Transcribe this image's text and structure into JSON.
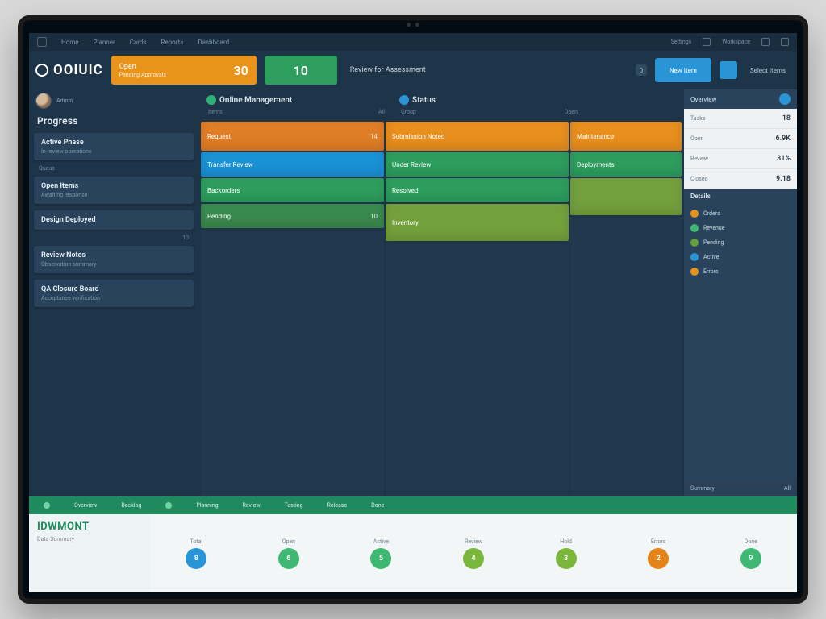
{
  "topnav": {
    "items": [
      "Home",
      "Planner",
      "Cards",
      "Reports",
      "Dashboard"
    ],
    "right": [
      "Settings",
      "Workspace"
    ]
  },
  "brand": "OOIUIC",
  "stats": {
    "orange": {
      "label": "Open",
      "sub": "Pending Approvals",
      "value": "30"
    },
    "green": {
      "value": "10"
    },
    "text": "Review for Assessment",
    "blue": "New Item",
    "gray": "Select Items"
  },
  "avatar_role": "Admin",
  "left": {
    "title": "Progress",
    "items": [
      {
        "title": "Active Phase",
        "sub": "In-review operations"
      },
      {
        "title": "Open Items",
        "sub": "Awaiting response"
      },
      {
        "title": "Design Deployed",
        "sub": ""
      },
      {
        "title": "Review Notes",
        "sub": "Observation summary"
      },
      {
        "title": "QA Closure Board",
        "sub": "Acceptance verification"
      }
    ],
    "small1": "Queue",
    "small2": "10"
  },
  "cols": {
    "left": {
      "title": "Online Management",
      "sub_l": "Items",
      "sub_r": "All"
    },
    "right": {
      "title": "Status",
      "sub_l": "Group",
      "sub_r": "Open"
    }
  },
  "tiles": {
    "l": [
      {
        "cls": "t-orange",
        "label": "Request",
        "num": "14"
      },
      {
        "cls": "t-blue",
        "label": "Transfer Review",
        "num": ""
      },
      {
        "cls": "t-green",
        "label": "Backorders",
        "num": ""
      },
      {
        "cls": "t-darkgreen",
        "label": "Pending",
        "num": "10"
      }
    ],
    "r": [
      {
        "cls": "t-orange2",
        "label": "Submission Noted",
        "num": ""
      },
      {
        "cls": "t-green",
        "label": "Under Review",
        "num": ""
      },
      {
        "cls": "t-green",
        "label": "Resolved",
        "num": ""
      },
      {
        "cls": "t-olive",
        "label": "Inventory",
        "num": ""
      }
    ],
    "r2": [
      {
        "cls": "t-orange2",
        "label": "Maintenance",
        "num": ""
      },
      {
        "cls": "t-green",
        "label": "Deployments",
        "num": ""
      },
      {
        "cls": "t-olive",
        "label": "",
        "num": ""
      }
    ]
  },
  "right": {
    "head": "Overview",
    "rows": [
      {
        "label": "Tasks",
        "val": "18"
      },
      {
        "label": "Open",
        "val": "6.9K"
      },
      {
        "label": "Review",
        "val": "31%"
      },
      {
        "label": "Closed",
        "val": "9.18"
      }
    ],
    "sect": "Details",
    "list": [
      "Orders",
      "Revenue",
      "Pending",
      "Active",
      "Errors"
    ],
    "foot_l": "Summary",
    "foot_r": "All"
  },
  "bottom": {
    "bar": [
      "Overview",
      "Backlog",
      "Planning",
      "Review",
      "Testing",
      "Release",
      "Done"
    ],
    "brand": "IDWMONT",
    "sub": "Data Summary",
    "cols": [
      {
        "label": "Total",
        "val": "8",
        "c": "c-blue"
      },
      {
        "label": "Open",
        "val": "6",
        "c": "c-green"
      },
      {
        "label": "Active",
        "val": "5",
        "c": "c-green"
      },
      {
        "label": "Review",
        "val": "4",
        "c": "c-lime"
      },
      {
        "label": "Hold",
        "val": "3",
        "c": "c-lime"
      },
      {
        "label": "Errors",
        "val": "2",
        "c": "c-orange"
      },
      {
        "label": "Done",
        "val": "9",
        "c": "c-green"
      }
    ]
  }
}
